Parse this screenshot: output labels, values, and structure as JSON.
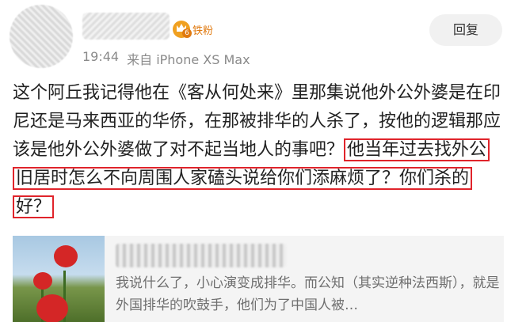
{
  "post": {
    "badge_level": "6",
    "badge_label": "铁粉",
    "time": "19:44",
    "source": "来自 iPhone XS Max",
    "reply_label": "回复",
    "text_plain": "这个阿丘我记得他在《客从何处来》里那集说他外公外婆是在印尼还是马来西亚的华侨，在那被排华的人杀了，按他的逻辑那应该是他外公外婆做了对不起当地人的事吧？",
    "text_highlighted": "他当年过去找外公旧居时怎么不向周围人家磕头说给你们添麻烦了？你们杀的好？",
    "highlight_color": "#e0242b"
  },
  "repost": {
    "text": "我说什么了，小心演变成排华。而公知（其实逆种法西斯），就是外国排华的吹鼓手，他们为了中国人被…"
  },
  "icons": {
    "badge": "crown-fan-badge-icon"
  }
}
